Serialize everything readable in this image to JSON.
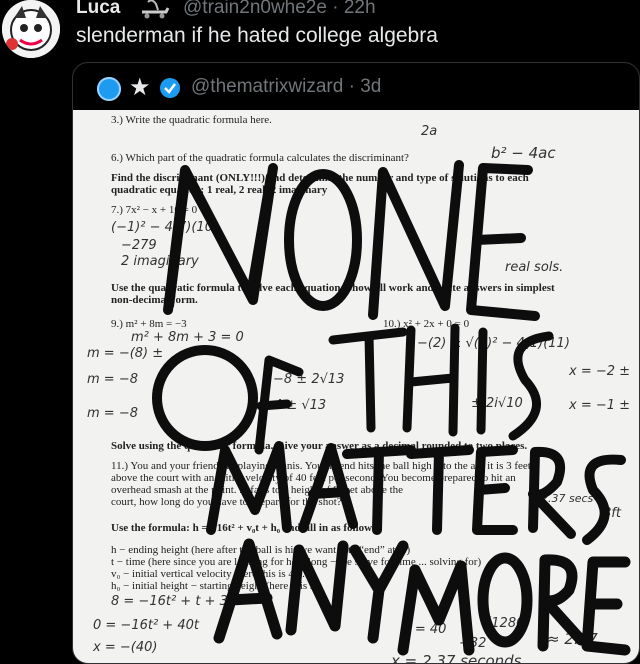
{
  "tweet": {
    "user_name": "Luca",
    "handle_time": "@train2n0whe2e · 22h",
    "text": "slenderman if he hated college algebra"
  },
  "quoted": {
    "handle_time": "@thematrixwizard · 3d",
    "star": "★"
  },
  "worksheet": {
    "q6": "6.) Which part of the quadratic formula calculates the discriminant?",
    "find_line1": "Find the discriminant (ONLY!!!) and determine the number and type of solutions to each",
    "find_line2": "quadratic equation: 1 real, 2 real, 2 imaginary",
    "q7": "7.) 7x² − x + 10 = 0",
    "use_line1": "Use the quadratic formula to solve each equation. Show all work and write answers in simplest",
    "use_line2": "non-decimal form.",
    "q9": "9.) m² + 8m = −3",
    "q10": "10.) x² + 2x + 0 = 0",
    "solve_line": "Solve using the quadratic formula. Give your answer as a decimal rounded to two places.",
    "q11": "11.) You and your friend are playing tennis. Your friend hits the ball high into the air, it is 3 feet",
    "q11b": "above the court with an initial velocity of 40 feet per second. You become prepared to hit an",
    "q11c": "overhead smash at the point. ... falls to a height of 8 feet above the",
    "q11d": "court, how long do you have to prepare for the shot?",
    "use_formula": "Use the formula: h = −16t² + v₀t + h₀ and fill in as follows:",
    "def1": "h − ending height (here after the ball is hit we want it to “end” at ...)",
    "def2": "t − time (here since you are looking for how long − we solve for time ... solving for)",
    "def3": "v₀ − initial vertical velocity (here this is 40 ...)",
    "def4": "h₀ − initial height − starting height (here it is 3)"
  },
  "handwriting": {
    "a_top": "2a",
    "b2": "b² − 4ac",
    "eq7": "(−1)² − 4(7)(10)",
    "neg279": "−279",
    "two_imag": "2 imaginary",
    "real_sols": "real sols.",
    "m_work1": "m² + 8m + 3 = 0",
    "m_eq1": "m = −(8) ±",
    "m_eq2": "m = −8",
    "m_eq3": "m = −8",
    "frac1": "−8 ± 2√13",
    "frac2": "−4 ± √13",
    "x_eq": "x = −2 ±",
    "x_eq2": "x = −1 ±",
    "two_i10": "± 2i√10",
    "eq_b": "−(2) ± √(2)² − 4(1)(11)",
    "eight": "8 = −16t² + t + 3",
    "zero": "0 = −16t² + 40t",
    "x_minus40": "x = −(40)",
    "x40": "x = 40",
    "val1280": "√1280",
    "neg32": "−32",
    "approx": "≈ 2.37",
    "ans": "x = 2.37 seconds",
    "eightft": "8ft",
    "secs": "2.37 secs"
  },
  "overlay_text": {
    "line1": "NONE",
    "line2": "OF THIS",
    "line3": "MATTERS",
    "line4": "ANYMORE"
  }
}
